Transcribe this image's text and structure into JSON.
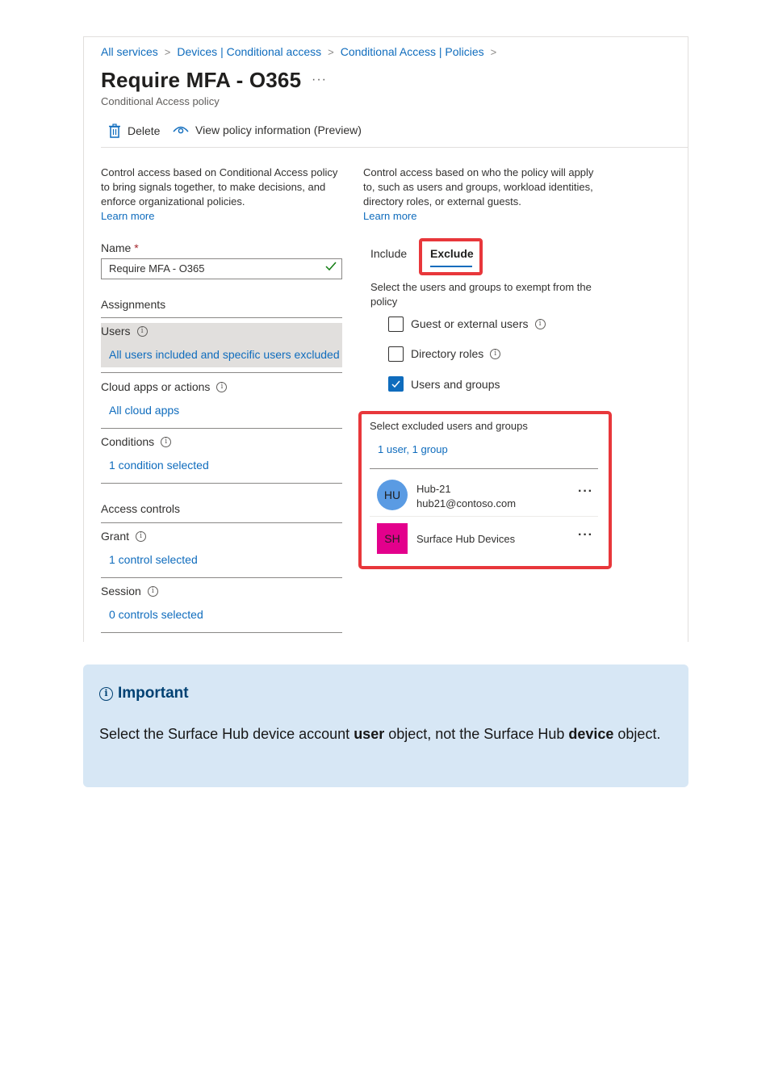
{
  "breadcrumb": [
    "All services",
    "Devices | Conditional access",
    "Conditional Access | Policies"
  ],
  "page": {
    "title": "Require MFA - O365",
    "more": "···",
    "subtitle": "Conditional Access policy"
  },
  "toolbar": {
    "delete_label": "Delete",
    "view_info_label": "View policy information (Preview)"
  },
  "left_panel": {
    "description": "Control access based on Conditional Access policy to bring signals together, to make decisions, and enforce organizational policies.",
    "learn_more": "Learn more",
    "name_label": "Name",
    "name_required": "*",
    "name_value": "Require MFA - O365",
    "assignments_heading": "Assignments",
    "users_label": "Users",
    "users_link": "All users included and specific users excluded",
    "cloud_apps_label": "Cloud apps or actions",
    "cloud_apps_link": "All cloud apps",
    "conditions_label": "Conditions",
    "conditions_link": "1 condition selected",
    "access_controls_heading": "Access controls",
    "grant_label": "Grant",
    "grant_link": "1 control selected",
    "session_label": "Session",
    "session_link": "0 controls selected"
  },
  "right_panel": {
    "description": "Control access based on who the policy will apply to, such as users and groups, workload identities, directory roles, or external guests.",
    "learn_more": "Learn more",
    "tabs": {
      "include": "Include",
      "exclude": "Exclude"
    },
    "exempt_text": "Select the users and groups to exempt from the policy",
    "options": [
      {
        "label": "Guest or external users",
        "checked": false
      },
      {
        "label": "Directory roles",
        "checked": false
      },
      {
        "label": "Users and groups",
        "checked": true
      }
    ],
    "excluded_heading": "Select excluded users and groups",
    "excluded_summary": "1 user, 1 group",
    "excluded_items": [
      {
        "initials": "HU",
        "name": "Hub-21",
        "email": "hub21@contoso.com",
        "more": "···"
      },
      {
        "initials": "SH",
        "name": "Surface Hub Devices",
        "more": "···"
      }
    ]
  },
  "callout": {
    "title": "Important",
    "text_1": "Select the Surface Hub device account ",
    "bold_1": "user",
    "text_2": " object, not the Surface Hub ",
    "bold_2": "device",
    "text_3": " object."
  },
  "colors": {
    "link": "#0f6cbd",
    "highlight_border": "#e8373b",
    "callout_bg": "#d7e7f5",
    "callout_title": "#004173",
    "avatar_hu": "#5a9be3",
    "avatar_sh": "#e3008c"
  }
}
